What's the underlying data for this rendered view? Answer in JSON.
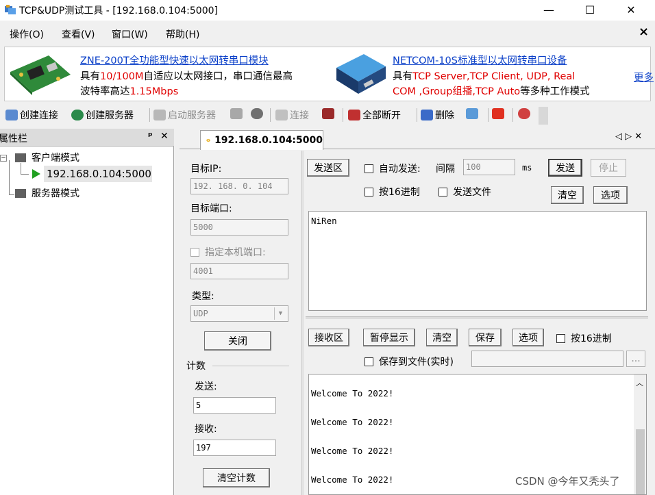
{
  "window": {
    "title": "TCP&UDP测试工具 - [192.168.0.104:5000]",
    "min_icon": "—",
    "max_icon": "☐",
    "close_icon": "✕"
  },
  "menu": {
    "items": [
      "操作(O)",
      "查看(V)",
      "窗口(W)",
      "帮助(H)"
    ],
    "close_glyph": "×"
  },
  "banner": {
    "left": {
      "title": "ZNE-200T全功能型快速以太网转串口模块",
      "l2a": "具有",
      "l2b": "10/100M",
      "l2c": "自适应以太网接口，串口通信最高",
      "l3a": "波特率高达",
      "l3b": "1.15Mbps"
    },
    "right": {
      "title": "NETCOM-10S标准型以太网转串口设备",
      "l2a": "具有",
      "l2b": "TCP Server,TCP Client, UDP, Real",
      "l3a": "COM ,Group组播,TCP Auto",
      "l3b": "等多种工作模式"
    },
    "more": "更多"
  },
  "toolbar": {
    "create_conn": "创建连接",
    "create_server": "创建服务器",
    "start_server": "启动服务器",
    "connect": "连接",
    "disconnect_all": "全部断开",
    "delete": "删除"
  },
  "sidebar": {
    "header": "属性栏",
    "pin": "ᵖ",
    "close": "✕",
    "client_mode": "客户端模式",
    "client_item": "192.168.0.104:5000",
    "server_mode": "服务器模式"
  },
  "tab": {
    "label": "192.168.0.104:5000",
    "nav": "◁ ▷ ✕"
  },
  "left": {
    "target_ip_label": "目标IP:",
    "target_ip": "192. 168. 0. 104",
    "target_port_label": "目标端口:",
    "target_port": "5000",
    "local_port_label": "指定本机端口:",
    "local_port": "4001",
    "type_label": "类型:",
    "type_value": "UDP",
    "close_btn": "关闭",
    "count_label": "计数",
    "send_label": "发送:",
    "send_count": "5",
    "recv_label": "接收:",
    "recv_count": "197",
    "clear_count_btn": "清空计数"
  },
  "send": {
    "area_btn": "发送区",
    "auto_send": "自动发送:",
    "interval_label": "间隔",
    "interval": "100",
    "ms": "ms",
    "send_btn": "发送",
    "stop_btn": "停止",
    "hex": "按16进制",
    "send_file": "发送文件",
    "clear_btn": "清空",
    "options_btn": "选项",
    "content": "NiRen"
  },
  "recv": {
    "area_btn": "接收区",
    "pause_btn": "暂停显示",
    "clear_btn": "清空",
    "save_btn": "保存",
    "options_btn": "选项",
    "hex": "按16进制",
    "save_to_file": "保存到文件(实时)",
    "browse": "...",
    "lines": [
      "Welcome To 2022!",
      "Welcome To 2022!",
      "Welcome To 2022!",
      "Welcome To 2022!"
    ]
  },
  "watermark": "CSDN @今年又秃头了"
}
